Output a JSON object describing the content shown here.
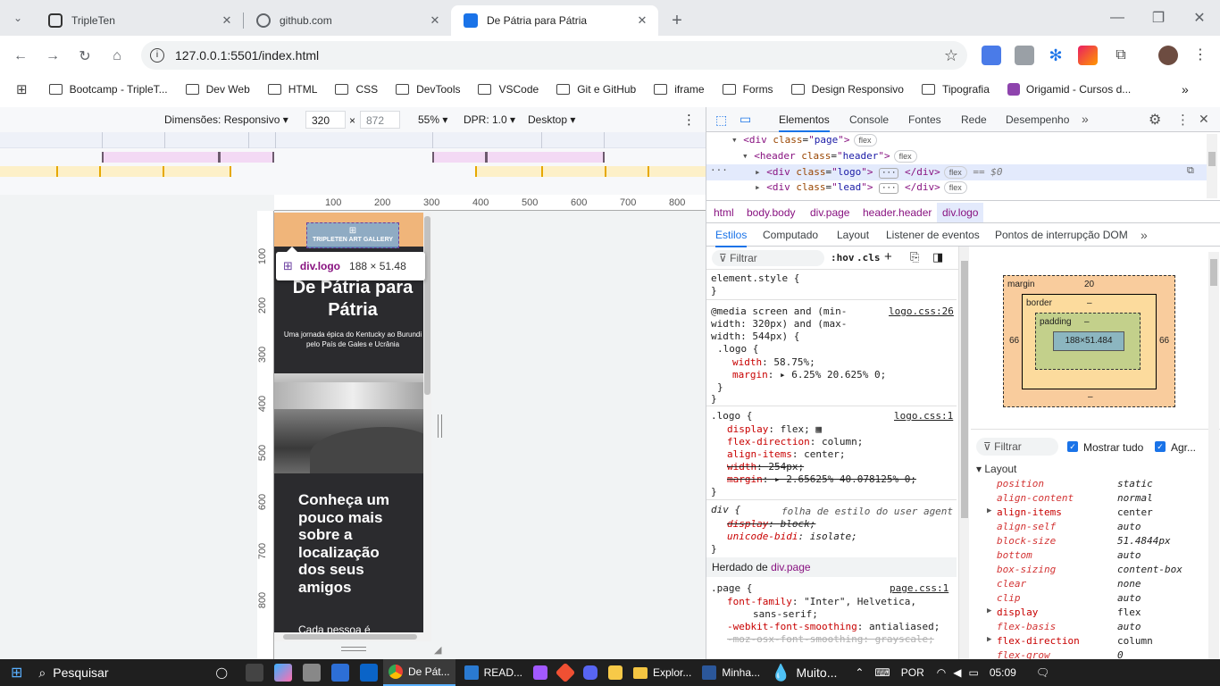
{
  "tabs": [
    {
      "title": "TripleTen",
      "active": false
    },
    {
      "title": "github.com",
      "active": false
    },
    {
      "title": "De Pátria para Pátria",
      "active": true
    }
  ],
  "address": {
    "url": "127.0.0.1:5501/index.html"
  },
  "bookmarks": [
    "Bootcamp - TripleT...",
    "Dev Web",
    "HTML",
    "CSS",
    "DevTools",
    "VSCode",
    "Git e GitHub",
    "iframe",
    "Forms",
    "Design Responsivo",
    "Tipografia",
    "Origamid - Cursos d..."
  ],
  "device_toolbar": {
    "dimensions": "Dimensões: Responsivo",
    "width": "320",
    "height": "872",
    "zoom": "55%",
    "dpr": "DPR: 1.0",
    "mode": "Desktop",
    "times": "×"
  },
  "rulers": {
    "h": [
      "100",
      "200",
      "300",
      "400",
      "500",
      "600",
      "700",
      "800"
    ],
    "v": [
      "100",
      "200",
      "300",
      "400",
      "500",
      "600",
      "700",
      "800"
    ]
  },
  "page_preview": {
    "logo_text": "TRIPLETEN ART GALLERY",
    "tooltip_name": "div.logo",
    "tooltip_size": "188 × 51.48",
    "title": "De Pátria para Pátria",
    "subtitle": "Uma jornada épica do Kentucky ao Burundi pelo País de Gales e Ucrânia",
    "section_title": "Conheça um pouco mais sobre a localização dos seus amigos",
    "body_start": "Cada pessoa é"
  },
  "devtools": {
    "tabs": [
      "Elementos",
      "Console",
      "Fontes",
      "Rede",
      "Desempenho"
    ],
    "dom": [
      {
        "indent": 0,
        "tag": "div",
        "attr": "class",
        "value": "page",
        "badge": "flex"
      },
      {
        "indent": 1,
        "tag": "header",
        "attr": "class",
        "value": "header",
        "badge": "flex"
      },
      {
        "indent": 2,
        "tag": "div",
        "attr": "class",
        "value": "logo",
        "badge": "flex",
        "selected": true,
        "suffix": "== $0"
      },
      {
        "indent": 2,
        "tag": "div",
        "attr": "class",
        "value": "lead",
        "badge": "flex"
      }
    ],
    "breadcrumbs": [
      "html",
      "body.body",
      "div.page",
      "header.header",
      "div.logo"
    ],
    "subtabs": [
      "Estilos",
      "Computado",
      "Layout",
      "Listener de eventos",
      "Pontos de interrupção DOM"
    ],
    "filter_placeholder": "Filtrar",
    "hov": ":hov",
    "cls": ".cls",
    "styles": {
      "element_style": "element.style {",
      "close": "}",
      "media_line1": "@media screen and (min-",
      "media_line2": "width: 320px) and (max-",
      "media_line3": "width: 544px) {",
      "media_src": "logo.css:26",
      "media_rule": ".logo {",
      "media_props": [
        {
          "p": "width",
          "v": "58.75%;"
        },
        {
          "p": "margin",
          "v": "▸ 6.25% 20.625% 0;"
        }
      ],
      "logo_rule": ".logo {",
      "logo_src": "logo.css:1",
      "logo_props": [
        {
          "p": "display",
          "v": "flex;",
          "struck": false
        },
        {
          "p": "flex-direction",
          "v": "column;",
          "struck": false
        },
        {
          "p": "align-items",
          "v": "center;",
          "struck": false
        },
        {
          "p": "width",
          "v": "254px;",
          "struck": true
        },
        {
          "p": "margin",
          "v": "▸ 2.65625% 40.078125% 0;",
          "struck": true
        }
      ],
      "ua_rule": "div {",
      "ua_src": "folha de estilo do user agent",
      "ua_props": [
        {
          "p": "display",
          "v": "block;",
          "struck": true
        },
        {
          "p": "unicode-bidi",
          "v": "isolate;",
          "struck": false
        }
      ],
      "inherited_label": "Herdado de",
      "inherited_from": "div.page",
      "page_rule": ".page {",
      "page_src": "page.css:1",
      "page_props": [
        {
          "p": "font-family",
          "v": "\"Inter\", Helvetica,"
        },
        {
          "p": "",
          "v": "sans-serif;"
        },
        {
          "p": "-webkit-font-smoothing",
          "v": "antialiased;"
        },
        {
          "p": "-moz-osx-font-smoothing",
          "v": "grayscale;"
        }
      ]
    },
    "boxmodel": {
      "margin_label": "margin",
      "margin_top": "20",
      "margin_left": "66",
      "margin_right": "66",
      "margin_bottom": "–",
      "border_label": "border",
      "border_val": "–",
      "padding_label": "padding",
      "padding_val": "–",
      "content": "188×51.484"
    },
    "computed_filter": "Filtrar",
    "show_all": "Mostrar tudo",
    "group": "Agr...",
    "layout_group": "Layout",
    "computed": [
      {
        "p": "position",
        "v": "static",
        "inherited": true
      },
      {
        "p": "align-content",
        "v": "normal",
        "inherited": true
      },
      {
        "p": "align-items",
        "v": "center",
        "inherited": false,
        "expand": true
      },
      {
        "p": "align-self",
        "v": "auto",
        "inherited": true
      },
      {
        "p": "block-size",
        "v": "51.4844px",
        "inherited": true
      },
      {
        "p": "bottom",
        "v": "auto",
        "inherited": true
      },
      {
        "p": "box-sizing",
        "v": "content-box",
        "inherited": true
      },
      {
        "p": "clear",
        "v": "none",
        "inherited": true
      },
      {
        "p": "clip",
        "v": "auto",
        "inherited": true
      },
      {
        "p": "display",
        "v": "flex",
        "inherited": false,
        "expand": true
      },
      {
        "p": "flex-basis",
        "v": "auto",
        "inherited": true
      },
      {
        "p": "flex-direction",
        "v": "column",
        "inherited": false,
        "expand": true
      },
      {
        "p": "flex-grow",
        "v": "0",
        "inherited": true
      }
    ]
  },
  "taskbar": {
    "search": "Pesquisar",
    "apps": [
      "De Pát...",
      "READ...",
      "Explor...",
      "Minha...",
      "Muito..."
    ],
    "lang": "POR",
    "time": "05:09"
  },
  "colors": {
    "accent": "#1a73e8",
    "page_bg": "#2b2b2e",
    "header_bg": "#f0b57a",
    "selected_row": "#e3eafc"
  }
}
